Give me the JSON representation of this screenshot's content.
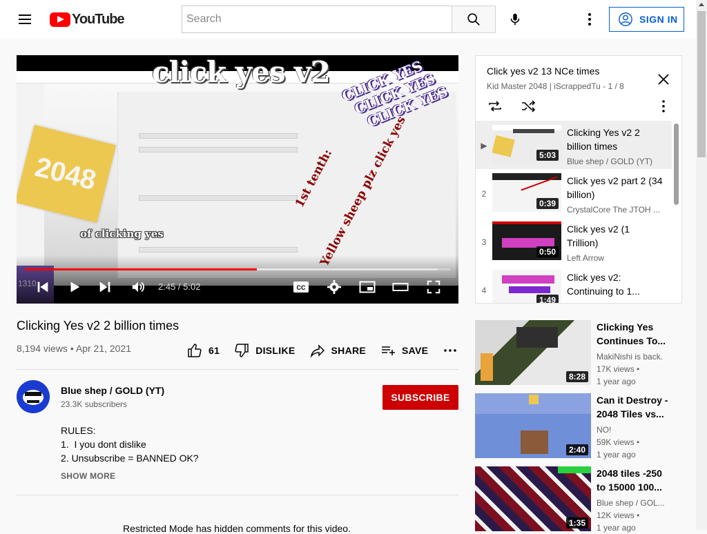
{
  "header": {
    "logo_text": "YouTube",
    "search_placeholder": "Search",
    "signin_label": "SIGN IN"
  },
  "player": {
    "overlay_title": "click yes v2",
    "overlay_clicks": [
      "CLICK YES",
      "CLICK YES",
      "CLICK YES"
    ],
    "overlay_sheep_line1": "1st tenth:",
    "overlay_sheep_line2": "Yellow sheep plz click yes",
    "overlay_tile": "2048",
    "overlay_of_clicking": "of clicking yes",
    "corner_number": "1310",
    "time_current": "2:45",
    "time_total": "5:02",
    "time_separator": " / ",
    "progress_played": 0.546,
    "progress_loaded": 0.97
  },
  "video": {
    "title": "Clicking Yes v2 2 billion times",
    "views": "8,194 views",
    "date": "Apr 21, 2021",
    "meta_separator": " • ",
    "likes": "61",
    "dislike_label": "DISLIKE",
    "share_label": "SHARE",
    "save_label": "SAVE"
  },
  "channel": {
    "name": "Blue shep / GOLD (YT)",
    "subscribers": "23.3K subscribers",
    "subscribe_label": "SUBSCRIBE"
  },
  "description": {
    "line1": "RULES:",
    "line2": "1.  I you dont dislike",
    "line3": "2. Unsubscribe = BANNED OK?",
    "show_more": "SHOW MORE"
  },
  "comments": {
    "restricted_text": "Restricted Mode has hidden comments for this video."
  },
  "playlist": {
    "title": "Click yes v2 13 NCe times",
    "owner": "Kid Master 2048",
    "separator": " | ",
    "channel": "iScrappedTu",
    "position": " - 1 / 8",
    "items": [
      {
        "index": "▶",
        "title": "Clicking Yes v2 2 billion times",
        "channel": "Blue shep / GOLD (YT)",
        "duration": "5:03",
        "color": "#e8e8e8"
      },
      {
        "index": "2",
        "title": "Click yes v2 part 2 (34 billion)",
        "channel": "CrystalCore The JTOH ...",
        "duration": "0:39",
        "color": "#f2f2f2"
      },
      {
        "index": "3",
        "title": "Click yes v2 (1 Trillion)",
        "channel": "Left Arrow",
        "duration": "0:50",
        "color": "#1a1a1a"
      },
      {
        "index": "4",
        "title": "Click yes v2: Continuing to 1...",
        "channel": "",
        "duration": "1:49",
        "color": "#f5f5f5"
      }
    ]
  },
  "recommendations": [
    {
      "title": "Clicking Yes Continues To...",
      "channel": "MakiNishi is back.",
      "views": "17K views",
      "views_dot": " •",
      "age": "1 year ago",
      "duration": "8:28",
      "color": "#3d3d3d"
    },
    {
      "title": "Can it Destroy - 2048 Tiles vs...",
      "channel": "NO!",
      "views": "59K views",
      "views_dot": " •",
      "age": "1 year ago",
      "duration": "2:40",
      "color": "#6a8fd8"
    },
    {
      "title": "2048 tiles -250 to 15000 100...",
      "channel": "Blue shep / GOL...",
      "views": "12K views",
      "views_dot": " •",
      "age": "1 year ago",
      "duration": "1:35",
      "color": "#7a1020"
    }
  ]
}
